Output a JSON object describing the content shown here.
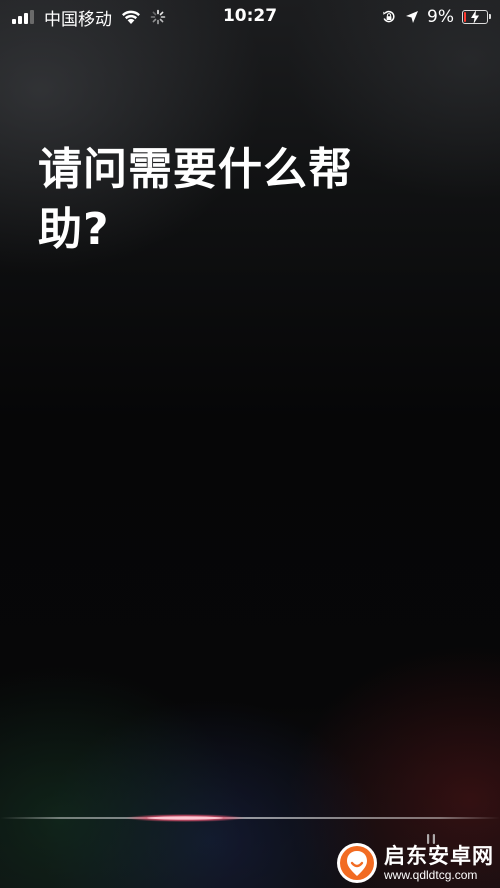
{
  "status_bar": {
    "carrier": "中国移动",
    "time": "10:27",
    "battery_percent": "9%",
    "battery_level": 0.09,
    "signal_bars_active": 3,
    "signal_bars_total": 4,
    "icons": [
      "signal-icon",
      "wifi-icon",
      "loading-spinner-icon",
      "orientation-lock-icon",
      "location-arrow-icon",
      "battery-charging-icon"
    ]
  },
  "siri": {
    "prompt": "请问需要什么帮助?",
    "icons": [
      "siri-waveform",
      "help-icon"
    ]
  },
  "watermark": {
    "name": "启东安卓网",
    "url": "www.qdldtcg.com"
  },
  "colors": {
    "battery_low": "#ff3b30",
    "wave_accent": "#ff5a78",
    "text": "#ffffff"
  }
}
